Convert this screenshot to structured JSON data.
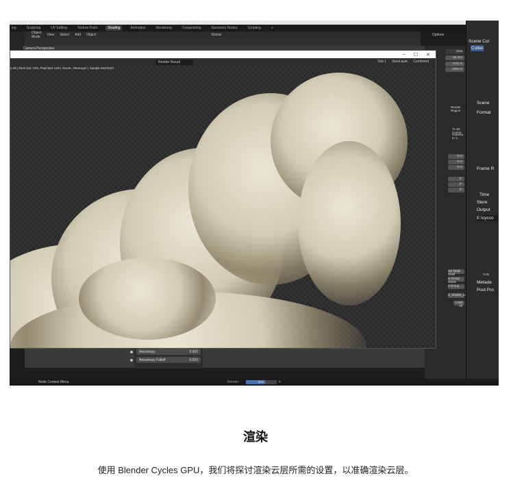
{
  "blender": {
    "workspace_tabs": [
      "ing",
      "Sculpting",
      "UV Editing",
      "Texture Paint",
      "Shading",
      "Animation",
      "Rendering",
      "Compositing",
      "Geometry Nodes",
      "Scripting",
      "+"
    ],
    "active_tab": "Shading",
    "header_menu": [
      "Object Mode",
      "View",
      "Select",
      "Add",
      "Object"
    ],
    "transform": "Global",
    "options": "Options",
    "camera_label": "Camera Perspective",
    "render_window": {
      "image_selector": "Render Result",
      "slot": "Slot 1",
      "view_layer": "ViewLayer",
      "pass": "Combined",
      "info": "0:48 | Mem:511.72M, Peak:654.11M | Scene, ViewLayer | Sample 640/1024",
      "minimize": "–",
      "maximize": "☐",
      "close": "✕"
    },
    "npanel": {
      "view": "View",
      "lens": "50 mm",
      "clip_start": "0.01 m",
      "clip_end": "1000 m",
      "render_region": "Render Region",
      "to_3d_cursor": "To 3D Cursor",
      "camera_to_view": "Camera to V...",
      "loc": [
        "0 m",
        "0 m",
        "0 m"
      ],
      "rot": [
        "0°",
        "0°",
        "0°"
      ],
      "node_buttons": [
        "our Node Shelf",
        "w Group Name",
        "n Group"
      ],
      "shader_select": "d_Shader_Lo...",
      "load_all": "Load All"
    },
    "properties": {
      "scene": "Scene",
      "format": "Format",
      "frame_range": "Frame R",
      "time": "Time",
      "stereo": "Stere",
      "output": "Output",
      "output_path": "E:\\cycco",
      "color": "Colo",
      "metadata": "Metada",
      "post": "Post Pro",
      "scene_collection": "Scene Col",
      "collection": "Collec"
    },
    "node": {
      "rows": [
        {
          "label": "Anisotropy",
          "value": "0.900"
        },
        {
          "label": "Anisotropy Falloff",
          "value": "0.500"
        }
      ]
    },
    "status": {
      "context_menu": "Node Context Menu",
      "render": "Render",
      "progress_text": "62%",
      "progress": 0.62
    }
  },
  "article": {
    "heading": "渲染",
    "body": "使用 Blender Cycles GPU，我们将探讨渲染云层所需的设置，以准确渲染云层。"
  }
}
